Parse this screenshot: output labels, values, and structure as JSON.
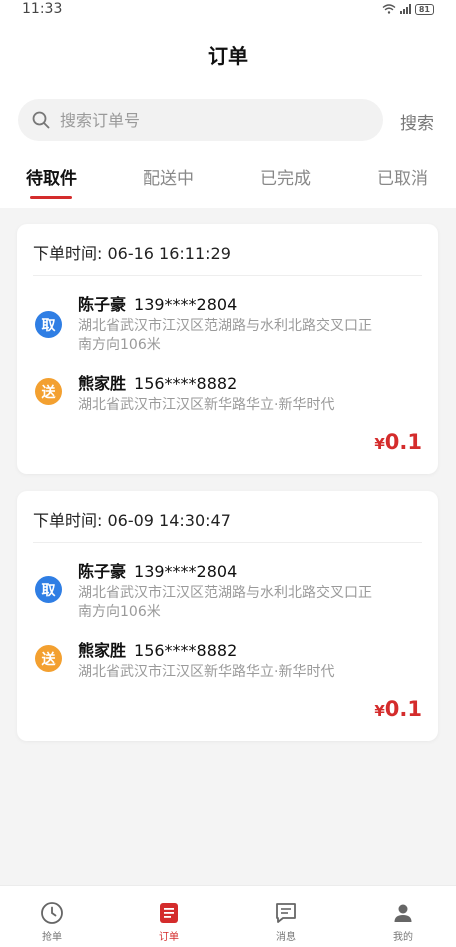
{
  "status": {
    "time": "11:33",
    "battery": "81"
  },
  "header": {
    "title": "订单"
  },
  "search": {
    "placeholder": "搜索订单号",
    "button_label": "搜索"
  },
  "tabs": [
    {
      "label": "待取件",
      "active": true
    },
    {
      "label": "配送中",
      "active": false
    },
    {
      "label": "已完成",
      "active": false
    },
    {
      "label": "已取消",
      "active": false
    }
  ],
  "orders": [
    {
      "time_label": "下单时间: 06-16 16:11:29",
      "pickup": {
        "badge": "取",
        "name": "陈子豪",
        "phone": "139****2804",
        "address": "湖北省武汉市江汉区范湖路与水利北路交叉口正南方向106米"
      },
      "delivery": {
        "badge": "送",
        "name": "熊家胜",
        "phone": "156****8882",
        "address": "湖北省武汉市江汉区新华路华立·新华时代"
      },
      "price_symbol": "¥",
      "price": "0.1"
    },
    {
      "time_label": "下单时间: 06-09 14:30:47",
      "pickup": {
        "badge": "取",
        "name": "陈子豪",
        "phone": "139****2804",
        "address": "湖北省武汉市江汉区范湖路与水利北路交叉口正南方向106米"
      },
      "delivery": {
        "badge": "送",
        "name": "熊家胜",
        "phone": "156****8882",
        "address": "湖北省武汉市江汉区新华路华立·新华时代"
      },
      "price_symbol": "¥",
      "price": "0.1"
    }
  ],
  "nav": [
    {
      "label": "抢单",
      "icon": "clock-icon",
      "active": false
    },
    {
      "label": "订单",
      "icon": "order-list-icon",
      "active": true
    },
    {
      "label": "消息",
      "icon": "message-icon",
      "active": false
    },
    {
      "label": "我的",
      "icon": "user-icon",
      "active": false
    }
  ],
  "colors": {
    "accent": "#d42c2c",
    "pickup": "#2f7ee4",
    "delivery": "#f3a030"
  }
}
